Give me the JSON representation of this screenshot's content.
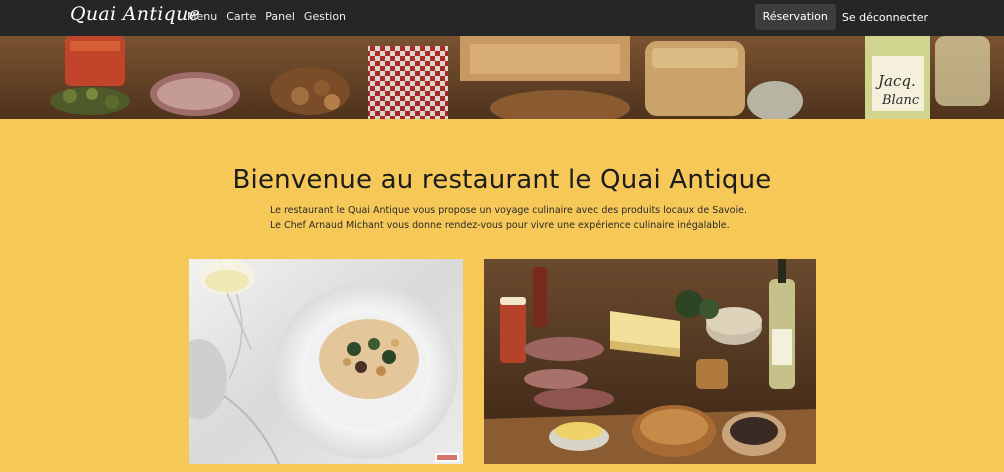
{
  "navbar": {
    "brand": "Quai Antique",
    "links": [
      "Menu",
      "Carte",
      "Panel",
      "Gestion"
    ],
    "reservation_label": "Réservation",
    "logout_label": "Se déconnecter"
  },
  "main": {
    "title": "Bienvenue au restaurant le Quai Antique",
    "intro_line1": "Le restaurant le Quai Antique vous propose un voyage culinaire avec des produits locaux de Savoie.",
    "intro_line2": "Le Chef Arnaud Michant vous donne rendez-vous pour vivre une expérience culinaire inégalable."
  },
  "colors": {
    "page_background": "#f5c858",
    "navbar_background": "#262626",
    "reservation_button": "#3d3d3d"
  }
}
